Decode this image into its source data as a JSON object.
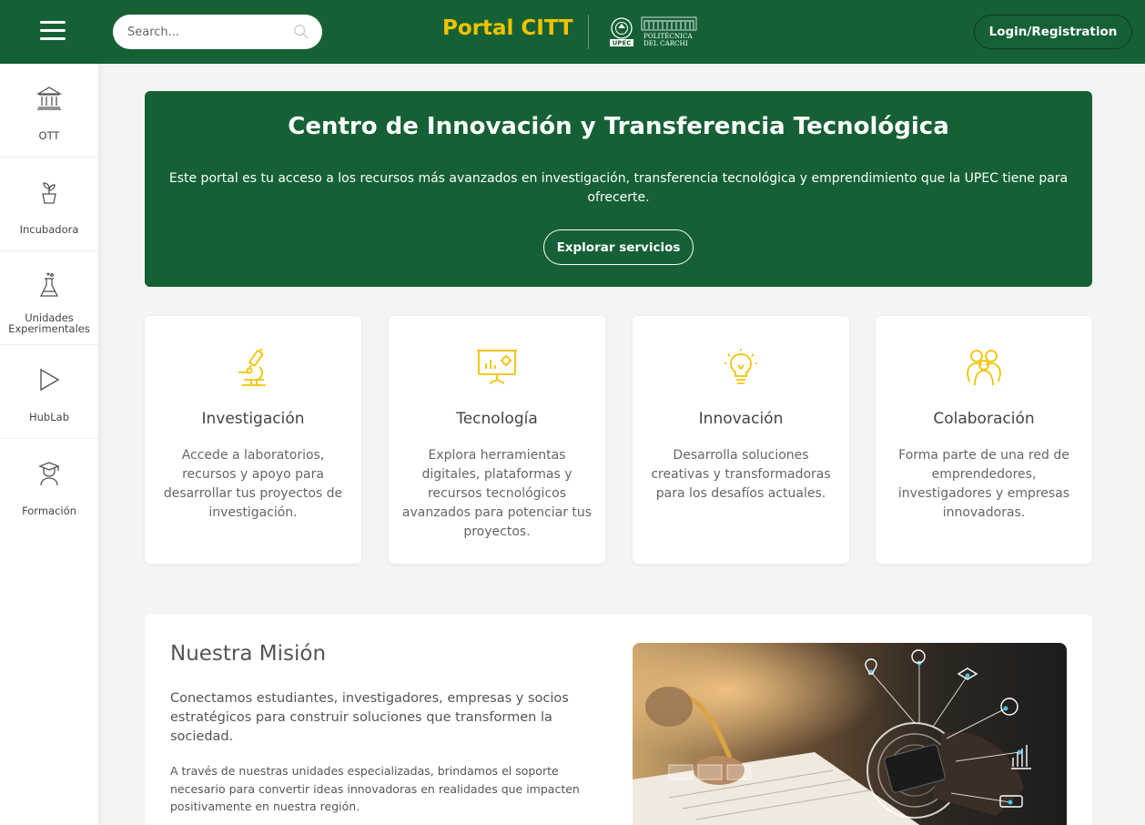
{
  "header": {
    "search_placeholder": "Search...",
    "brand": "Portal CITT",
    "logo_text": {
      "line1": "POLITÉCNICA",
      "line2": "DEL CARCHI",
      "acronym": "UPEC"
    },
    "login_label": "Login/Registration"
  },
  "sidebar": {
    "items": [
      {
        "label": "OTT",
        "icon": "bank-icon"
      },
      {
        "label": "Incubadora",
        "icon": "seedling-icon"
      },
      {
        "label": "Unidades Experimentales",
        "icon": "flask-icon"
      },
      {
        "label": "HubLab",
        "icon": "play-icon"
      },
      {
        "label": "Formación",
        "icon": "graduate-icon"
      }
    ]
  },
  "hero": {
    "title": "Centro de Innovación y Transferencia Tecnológica",
    "description": "Este portal es tu acceso a los recursos más avanzados en investigación, transferencia tecnológica y emprendimiento que la UPEC tiene para ofrecerte.",
    "button_label": "Explorar servicios"
  },
  "cards": [
    {
      "title": "Investigación",
      "text": "Accede a laboratorios, recursos y apoyo para desarrollar tus proyectos de investigación.",
      "icon": "microscope-icon"
    },
    {
      "title": "Tecnología",
      "text": "Explora herramientas digitales, plataformas y recursos tecnológicos avanzados para potenciar tus proyectos.",
      "icon": "presentation-chart-icon"
    },
    {
      "title": "Innovación",
      "text": "Desarrolla soluciones creativas y transformadoras para los desafíos actuales.",
      "icon": "lightbulb-icon"
    },
    {
      "title": "Colaboración",
      "text": "Forma parte de una red de emprendedores, investigadores y empresas innovadoras.",
      "icon": "team-icon"
    }
  ],
  "mission": {
    "title": "Nuestra Misión",
    "p1": "Conectamos estudiantes, investigadores, empresas y socios estratégicos para construir soluciones que transformen la sociedad.",
    "p2": "A través de nuestras unidades especializadas, brindamos el soporte necesario para convertir ideas innovadoras en realidades que impacten positivamente en nuestra región."
  },
  "colors": {
    "primary": "#156135",
    "accent": "#f2c200"
  }
}
